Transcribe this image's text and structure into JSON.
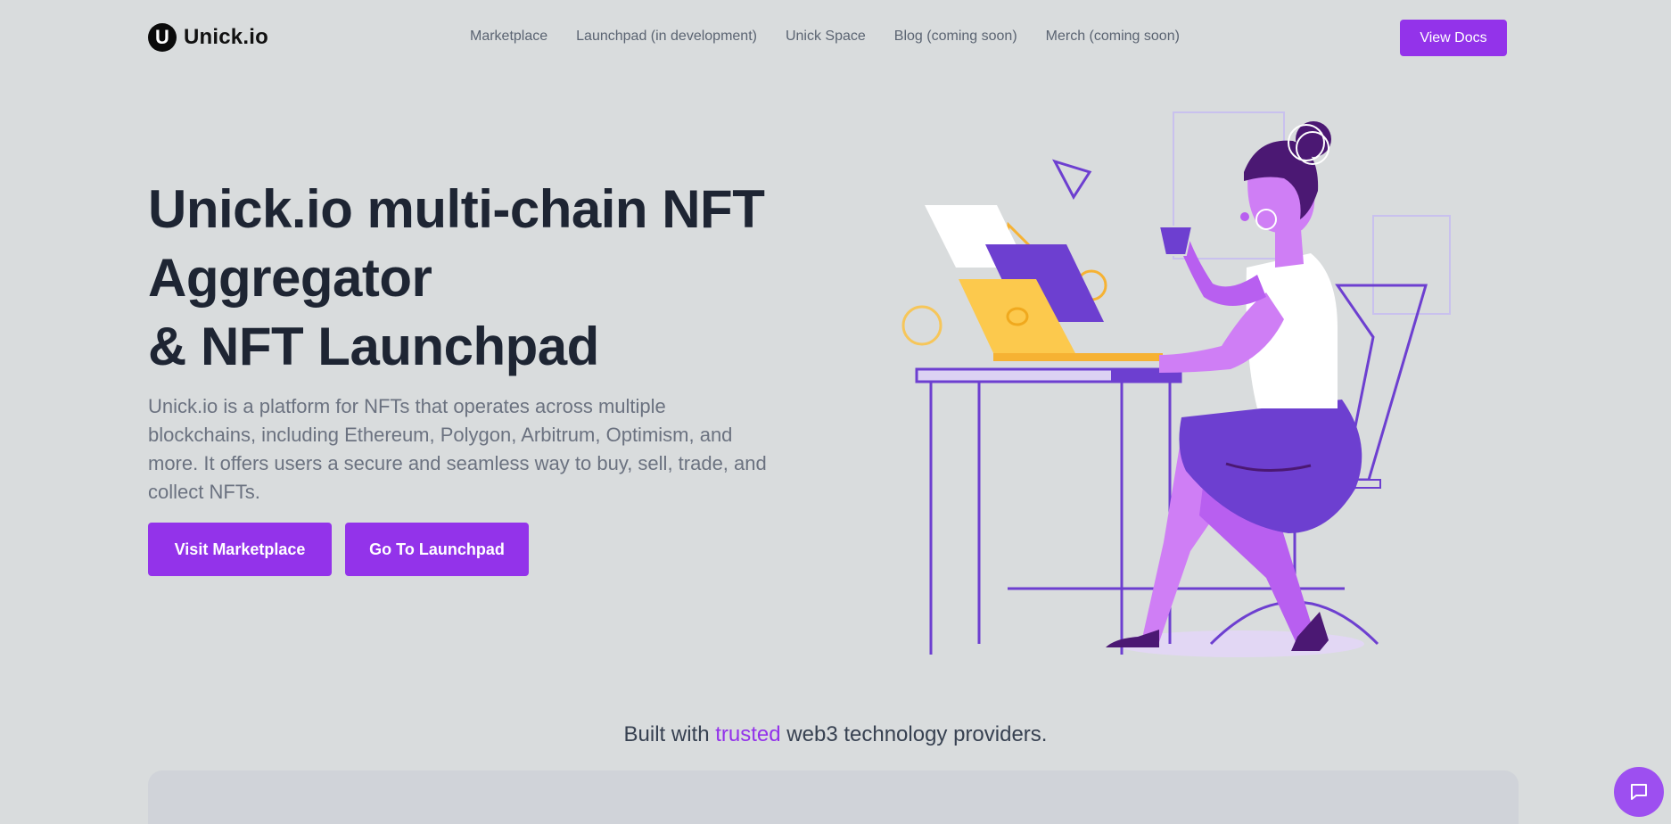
{
  "header": {
    "logo_text": "Unick.io",
    "nav": [
      {
        "label": "Marketplace"
      },
      {
        "label": "Launchpad (in development)"
      },
      {
        "label": "Unick Space"
      },
      {
        "label": "Blog (coming soon)"
      },
      {
        "label": "Merch (coming soon)"
      }
    ],
    "view_docs_label": "View Docs"
  },
  "hero": {
    "title_lines": [
      "Unick.io multi-chain NFT",
      "Aggregator",
      "& NFT Launchpad"
    ],
    "description": "Unick.io is a platform for NFTs that operates across multiple blockchains, including Ethereum, Polygon, Arbitrum, Optimism, and more. It offers users a secure and seamless way to buy, sell, trade, and collect NFTs.",
    "primary_button": "Visit Marketplace",
    "secondary_button": "Go To Launchpad"
  },
  "providers": {
    "prefix": "Built with",
    "highlight": "trusted",
    "suffix": "web3 technology providers."
  },
  "icons": {
    "logo": "u-logo-icon",
    "chat": "chat-bubble-icon"
  },
  "colors": {
    "accent": "#9333ea",
    "background": "#d9dcdd",
    "heading": "#1e2533",
    "body_text": "#6b7280"
  }
}
